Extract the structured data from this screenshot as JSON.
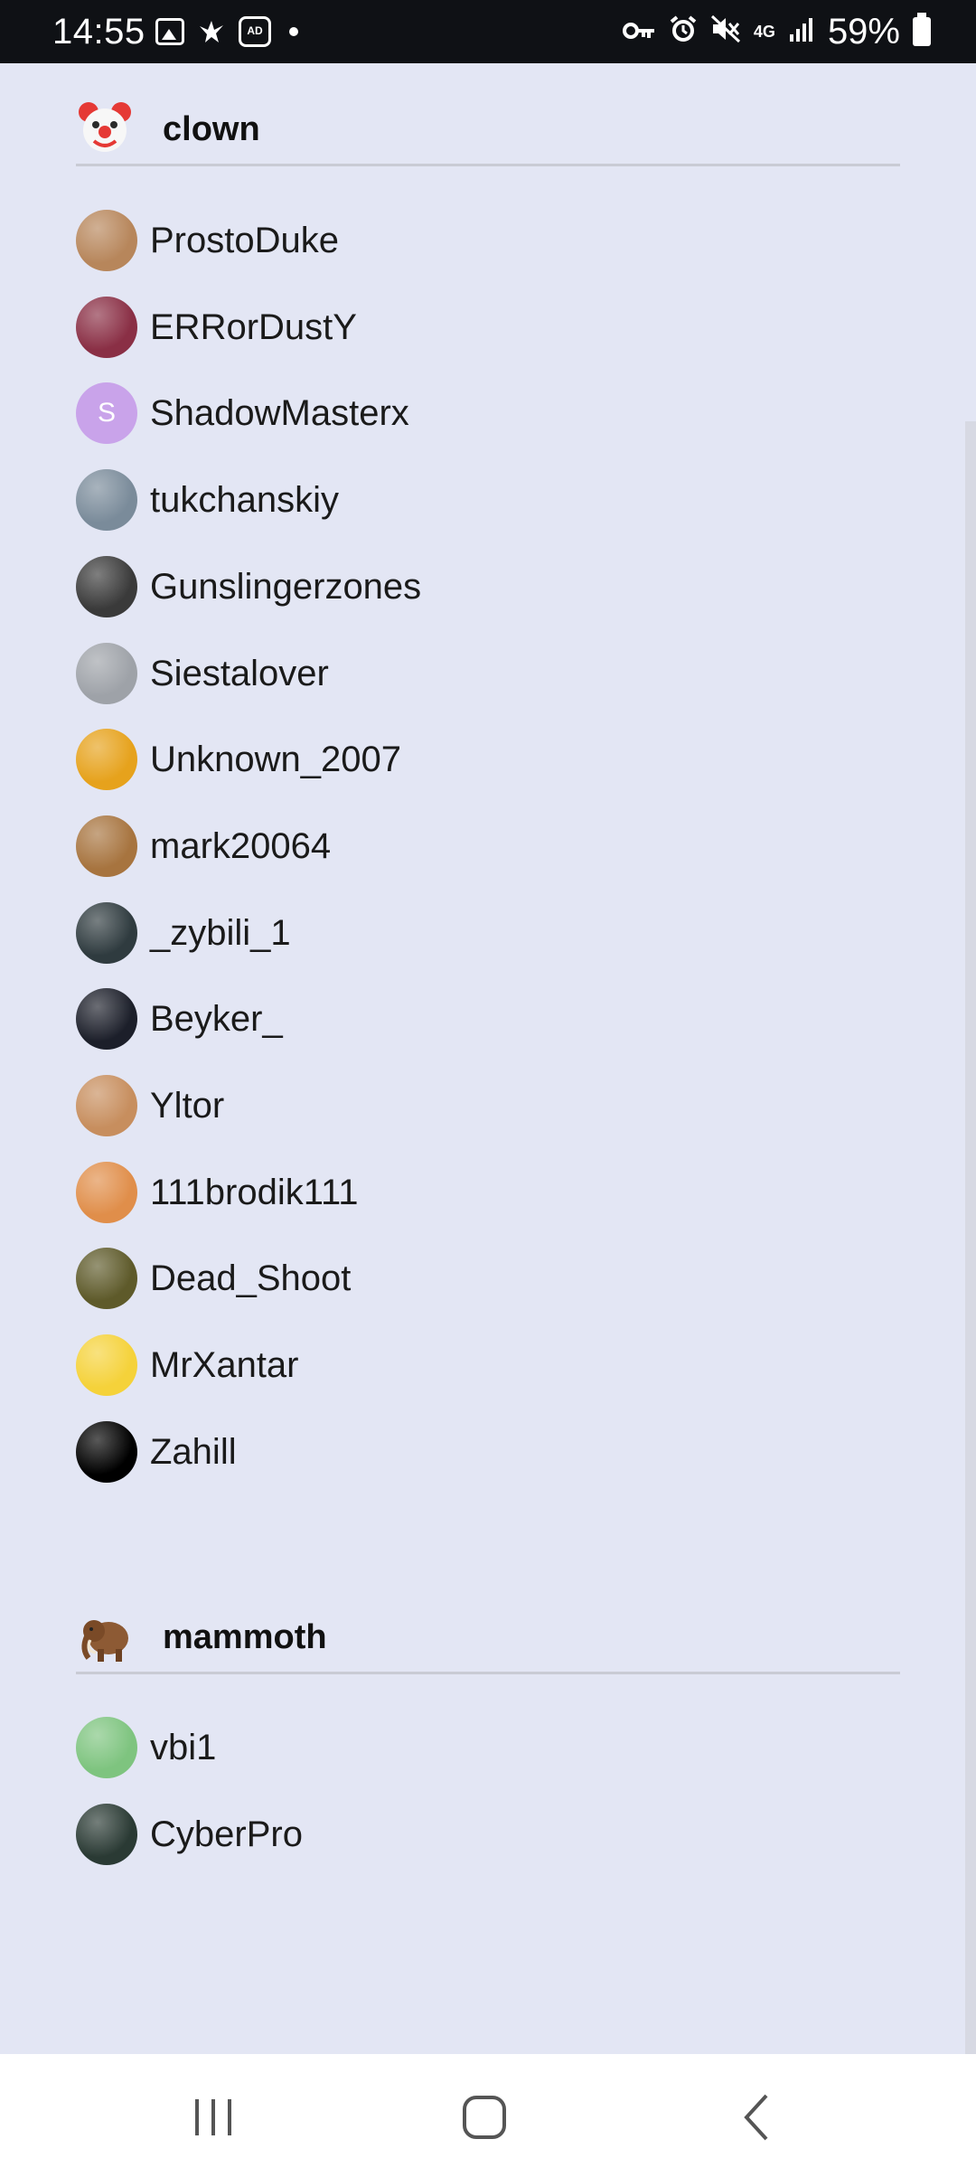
{
  "status_bar": {
    "time": "14:55",
    "left_icons": [
      "gallery-icon",
      "bird-icon",
      "ad-blocker-icon",
      "dot-icon"
    ],
    "ad_blocker_label": "AD",
    "right_icons": [
      "key-icon",
      "alarm-icon",
      "mute-icon",
      "4g-icon",
      "signal-icon",
      "battery-icon"
    ],
    "network_label": "4G",
    "battery": "59%"
  },
  "sections": [
    {
      "title": "clown",
      "emoji_icon": "clown-face-icon",
      "members": [
        {
          "name": "ProstoDuke",
          "avatar_color": "#b7865b"
        },
        {
          "name": "ERRorDustY",
          "avatar_color": "#8a2f45"
        },
        {
          "name": "ShadowMasterx",
          "avatar_letter": "S",
          "avatar_color": "#c9a3ea"
        },
        {
          "name": "tukchanskiy",
          "avatar_color": "#7a8b9a"
        },
        {
          "name": "Gunslingerzones",
          "avatar_color": "#3a3a3a"
        },
        {
          "name": "Siestalover",
          "avatar_color": "#9ea2a8"
        },
        {
          "name": "Unknown_2007",
          "avatar_color": "#e6a21c"
        },
        {
          "name": "mark20064",
          "avatar_color": "#a7743f"
        },
        {
          "name": "_zybili_1",
          "avatar_color": "#2f3b3f"
        },
        {
          "name": "Beyker_",
          "avatar_color": "#1c1f2a"
        },
        {
          "name": "Yltor",
          "avatar_color": "#c78e5e"
        },
        {
          "name": "111brodik111",
          "avatar_color": "#e08e4a"
        },
        {
          "name": "Dead_Shoot",
          "avatar_color": "#5e5a2a"
        },
        {
          "name": "MrXantar",
          "avatar_color": "#f5d23a"
        },
        {
          "name": "Zahill",
          "avatar_color": "#000000"
        }
      ]
    },
    {
      "title": "mammoth",
      "emoji_icon": "mammoth-icon",
      "members": [
        {
          "name": "vbi1",
          "avatar_color": "#7ec47f"
        },
        {
          "name": "CyberPro",
          "avatar_color": "#2a3a34"
        }
      ]
    }
  ],
  "nav_bar": {
    "buttons": [
      "recent-apps-icon",
      "home-icon",
      "back-icon"
    ]
  },
  "colors": {
    "background": "#e3e6f4",
    "status_bar": "#0f1115",
    "divider": "#c9cbd4"
  }
}
